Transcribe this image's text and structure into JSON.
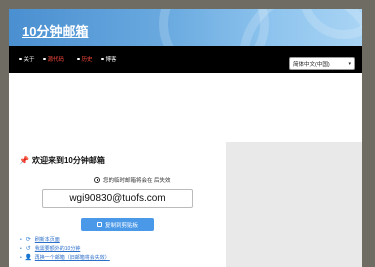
{
  "header": {
    "site_title": "10分钟邮箱"
  },
  "nav": {
    "items": [
      {
        "label": "关于",
        "color": "#ffffff"
      },
      {
        "label": "源代码",
        "color": "#ff4a3d"
      },
      {
        "label": "历史",
        "color": "#ff4a3d"
      },
      {
        "label": "博客",
        "color": "#ffffff"
      }
    ],
    "language": {
      "selected": "简体中文(中国)"
    }
  },
  "main": {
    "title": "欢迎来到10分钟邮箱",
    "expire_note": "您的临时邮箱将会在 后失效",
    "email": "wgi90830@tuofs.com",
    "copy_button": "复制到剪贴板"
  },
  "actions": [
    {
      "icon": "refresh-icon",
      "label": "刷新本页面"
    },
    {
      "icon": "undo-icon",
      "label": "我需要额外的10分钟"
    },
    {
      "icon": "person-icon",
      "label": "再换一个邮箱（旧邮箱将会失效）"
    }
  ]
}
